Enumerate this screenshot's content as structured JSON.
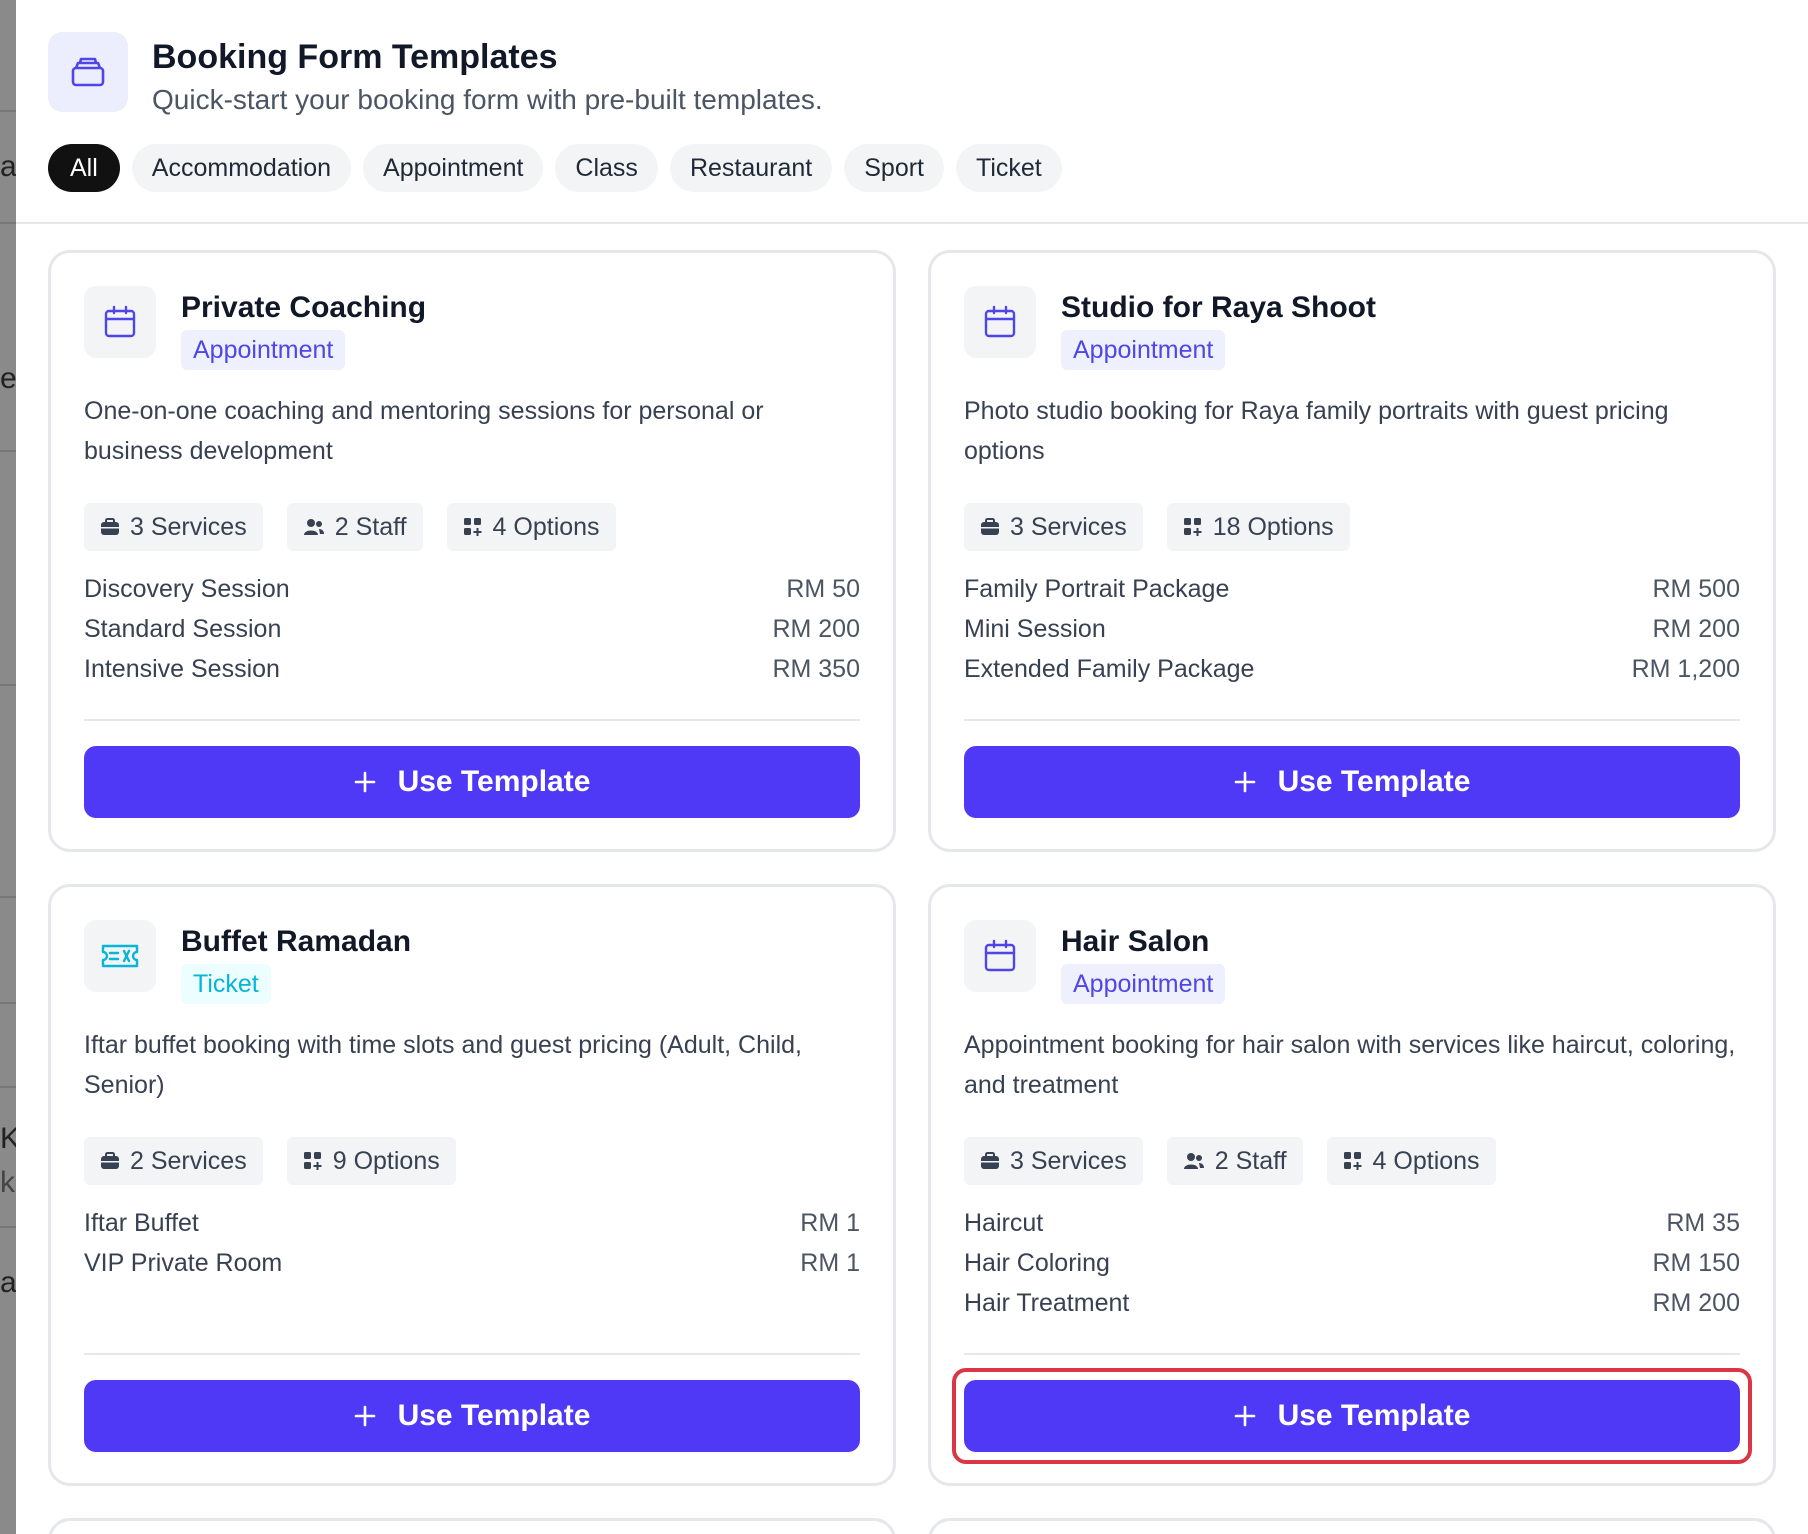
{
  "header": {
    "title": "Booking Form Templates",
    "subtitle": "Quick-start your booking form with pre-built templates.",
    "icon": "stack-icon"
  },
  "filters": [
    "All",
    "Accommodation",
    "Appointment",
    "Class",
    "Restaurant",
    "Sport",
    "Ticket"
  ],
  "active_filter": "All",
  "button_label": "Use Template",
  "background_fragments": [
    "a",
    "e",
    "K",
    "k",
    "a"
  ],
  "templates": [
    {
      "title": "Private Coaching",
      "category": "Appointment",
      "icon": "calendar-icon",
      "description": "One-on-one coaching and mentoring sessions for personal or business development",
      "stats": {
        "services": "3 Services",
        "staff": "2 Staff",
        "options": "4 Options"
      },
      "items": [
        {
          "name": "Discovery Session",
          "price": "RM 50"
        },
        {
          "name": "Standard Session",
          "price": "RM 200"
        },
        {
          "name": "Intensive Session",
          "price": "RM 350"
        }
      ]
    },
    {
      "title": "Studio for Raya Shoot",
      "category": "Appointment",
      "icon": "calendar-icon",
      "description": "Photo studio booking for Raya family portraits with guest pricing options",
      "stats": {
        "services": "3 Services",
        "options": "18 Options"
      },
      "items": [
        {
          "name": "Family Portrait Package",
          "price": "RM 500"
        },
        {
          "name": "Mini Session",
          "price": "RM 200"
        },
        {
          "name": "Extended Family Package",
          "price": "RM 1,200"
        }
      ]
    },
    {
      "title": "Buffet Ramadan",
      "category": "Ticket",
      "icon": "ticket-icon",
      "description": "Iftar buffet booking with time slots and guest pricing (Adult, Child, Senior)",
      "stats": {
        "services": "2 Services",
        "options": "9 Options"
      },
      "items": [
        {
          "name": "Iftar Buffet",
          "price": "RM 1"
        },
        {
          "name": "VIP Private Room",
          "price": "RM 1"
        }
      ]
    },
    {
      "title": "Hair Salon",
      "category": "Appointment",
      "icon": "calendar-icon",
      "description": "Appointment booking for hair salon with services like haircut, coloring, and treatment",
      "stats": {
        "services": "3 Services",
        "staff": "2 Staff",
        "options": "4 Options"
      },
      "items": [
        {
          "name": "Haircut",
          "price": "RM 35"
        },
        {
          "name": "Hair Coloring",
          "price": "RM 150"
        },
        {
          "name": "Hair Treatment",
          "price": "RM 200"
        }
      ]
    }
  ],
  "colors": {
    "primary": "#4f39f6",
    "appointment_tag_text": "#4f46e5",
    "appointment_tag_bg": "#eef0fe",
    "ticket_tag_text": "#06b6d4",
    "ticket_tag_bg": "#ecfeff",
    "highlight": "#dc3545"
  }
}
